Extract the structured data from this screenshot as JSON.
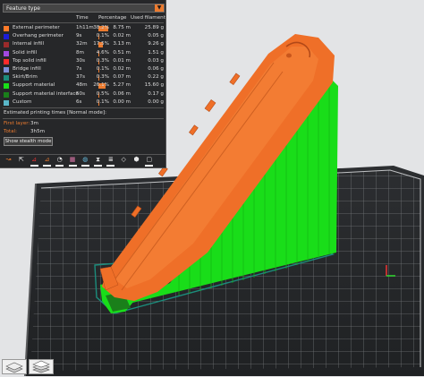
{
  "legend": {
    "dropdown_value": "Feature type",
    "dropdown_arrow": "▼",
    "headers": {
      "time": "Time",
      "percentage": "Percentage",
      "used_filament": "Used filament"
    },
    "rows": [
      {
        "name": "External perimeter",
        "time": "1h11m",
        "pct": "38.2%",
        "pct_value": 38.2,
        "m": "8.75 m",
        "g": "25.89 g",
        "color": "#ff7b29"
      },
      {
        "name": "Overhang perimeter",
        "time": "9s",
        "pct": "0.1%",
        "pct_value": 0.1,
        "m": "0.02 m",
        "g": "0.05 g",
        "color": "#1d1dd8"
      },
      {
        "name": "Internal infill",
        "time": "32m",
        "pct": "17.5%",
        "pct_value": 17.5,
        "m": "3.13 m",
        "g": "9.26 g",
        "color": "#9a2b2b"
      },
      {
        "name": "Solid infill",
        "time": "8m",
        "pct": "4.6%",
        "pct_value": 4.6,
        "m": "0.51 m",
        "g": "1.51 g",
        "color": "#a24ae0"
      },
      {
        "name": "Top solid infill",
        "time": "30s",
        "pct": "0.3%",
        "pct_value": 0.3,
        "m": "0.01 m",
        "g": "0.03 g",
        "color": "#ff2b2b"
      },
      {
        "name": "Bridge infill",
        "time": "7s",
        "pct": "0.1%",
        "pct_value": 0.1,
        "m": "0.02 m",
        "g": "0.06 g",
        "color": "#7f8fd9"
      },
      {
        "name": "Skirt/Brim",
        "time": "37s",
        "pct": "0.3%",
        "pct_value": 0.3,
        "m": "0.07 m",
        "g": "0.22 g",
        "color": "#1c8c7c"
      },
      {
        "name": "Support material",
        "time": "48m",
        "pct": "26.1%",
        "pct_value": 26.1,
        "m": "5.27 m",
        "g": "15.60 g",
        "color": "#19dd19"
      },
      {
        "name": "Support material interface",
        "time": "50s",
        "pct": "0.5%",
        "pct_value": 0.5,
        "m": "0.06 m",
        "g": "0.17 g",
        "color": "#1a7f1a"
      },
      {
        "name": "Custom",
        "time": "6s",
        "pct": "0.1%",
        "pct_value": 0.1,
        "m": "0.00 m",
        "g": "0.00 g",
        "color": "#5ab7c9"
      }
    ],
    "estimated_label": "Estimated printing times [Normal mode]:",
    "first_layer_label": "First layer:",
    "first_layer_value": "3m",
    "total_label": "Total:",
    "total_value": "3h5m",
    "stealth_button": "Show stealth mode"
  },
  "toolbar": {
    "icons": [
      {
        "name": "travel-icon",
        "glyph": "↝",
        "color": "#ec7b2f",
        "checked": false
      },
      {
        "name": "wipe-icon",
        "glyph": "⇱",
        "color": "#e6e6e6",
        "checked": false
      },
      {
        "name": "retractions-icon",
        "glyph": "⊿",
        "color": "#e33",
        "checked": true
      },
      {
        "name": "deretractions-icon",
        "glyph": "⊿",
        "color": "#ec7b2f",
        "checked": true
      },
      {
        "name": "seams-icon",
        "glyph": "◔",
        "color": "#e6e6e6",
        "checked": true
      },
      {
        "name": "tool-changes-icon",
        "glyph": "▦",
        "color": "#d7a",
        "checked": true
      },
      {
        "name": "color-changes-icon",
        "glyph": "◍",
        "color": "#6bd",
        "checked": true
      },
      {
        "name": "pause-icon",
        "glyph": "⧗",
        "color": "#e6e6e6",
        "checked": true
      },
      {
        "name": "custom-gcode-icon",
        "glyph": "≣",
        "color": "#e6e6e6",
        "checked": true
      },
      {
        "name": "shells-icon",
        "glyph": "◇",
        "color": "#e6e6e6",
        "checked": false
      },
      {
        "name": "tool-marker-icon",
        "glyph": "⬢",
        "color": "#e6e6e6",
        "checked": false
      },
      {
        "name": "legend-icon",
        "glyph": "▢",
        "color": "#e6e6e6",
        "checked": true
      }
    ]
  }
}
